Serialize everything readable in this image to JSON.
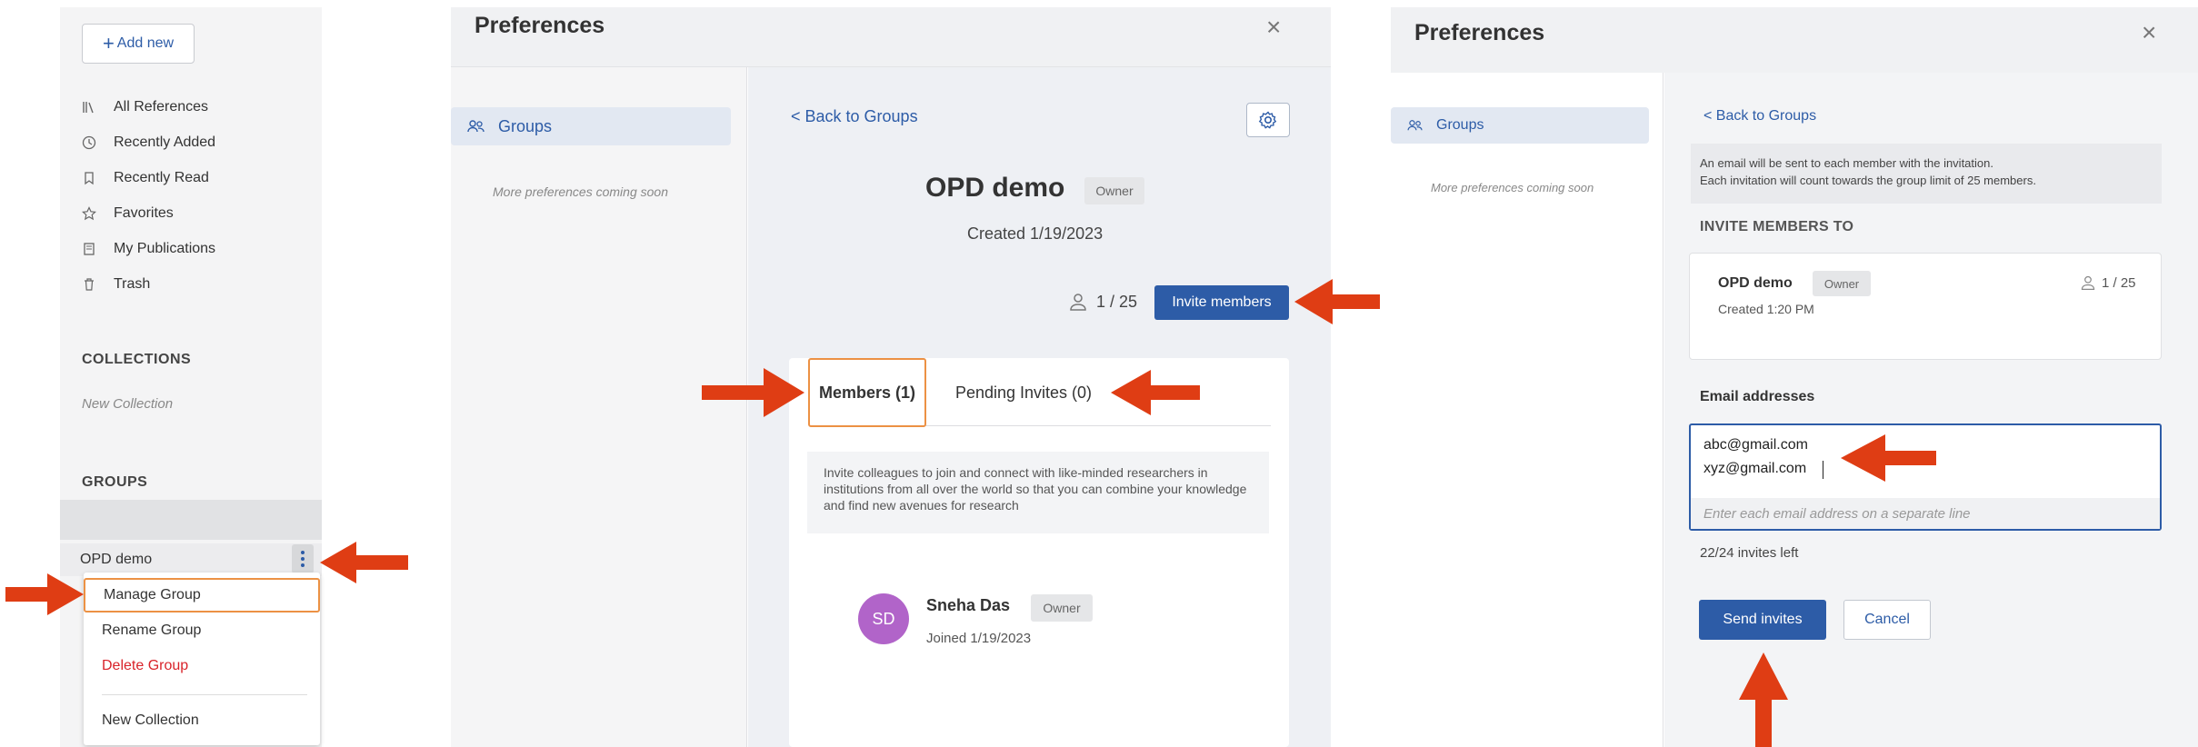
{
  "colors": {
    "accent": "#2d5ca7",
    "annotation_arrow": "#df3d14",
    "highlight": "#ec9144",
    "danger": "#d9232a",
    "avatar": "#b164c9"
  },
  "sidebar": {
    "add_new": "Add new",
    "items": [
      {
        "label": "All References",
        "icon": "library-icon"
      },
      {
        "label": "Recently Added",
        "icon": "clock-icon"
      },
      {
        "label": "Recently Read",
        "icon": "bookmark-icon"
      },
      {
        "label": "Favorites",
        "icon": "star-icon"
      },
      {
        "label": "My Publications",
        "icon": "publications-icon"
      },
      {
        "label": "Trash",
        "icon": "trash-icon"
      }
    ],
    "collections_heading": "COLLECTIONS",
    "new_collection": "New Collection",
    "groups_heading": "GROUPS",
    "group_name": "OPD demo",
    "context_menu": {
      "manage": "Manage Group",
      "rename": "Rename Group",
      "delete": "Delete Group",
      "new_collection": "New Collection"
    }
  },
  "manage_panel": {
    "title": "Preferences",
    "close": "×",
    "nav_groups": "Groups",
    "more_prefs": "More preferences coming soon",
    "back": "< Back to Groups",
    "group_name": "OPD demo",
    "owner_badge": "Owner",
    "created": "Created 1/19/2023",
    "member_count": "1 / 25",
    "invite_button": "Invite members",
    "tabs": {
      "members": "Members (1)",
      "pending": "Pending Invites (0)"
    },
    "info": "Invite colleagues to join and connect with like-minded researchers in institutions from all over the world so that you can combine your knowledge and find new avenues for research",
    "member": {
      "initials": "SD",
      "name": "Sneha Das",
      "badge": "Owner",
      "joined": "Joined 1/19/2023"
    }
  },
  "invite_panel": {
    "title": "Preferences",
    "close": "×",
    "nav_groups": "Groups",
    "more_prefs": "More preferences coming soon",
    "back": "< Back to Groups",
    "note_line1": "An email will be sent to each member with the invitation.",
    "note_line2": "Each invitation will count towards the group limit of 25 members.",
    "invite_to": "INVITE MEMBERS TO",
    "group_name": "OPD demo",
    "owner_badge": "Owner",
    "count": "1 / 25",
    "created": "Created 1:20 PM",
    "email_label": "Email addresses",
    "emails": [
      "abc@gmail.com",
      "xyz@gmail.com"
    ],
    "email_placeholder": "Enter each email address on a separate line",
    "invites_left": "22/24 invites left",
    "send": "Send invites",
    "cancel": "Cancel"
  }
}
